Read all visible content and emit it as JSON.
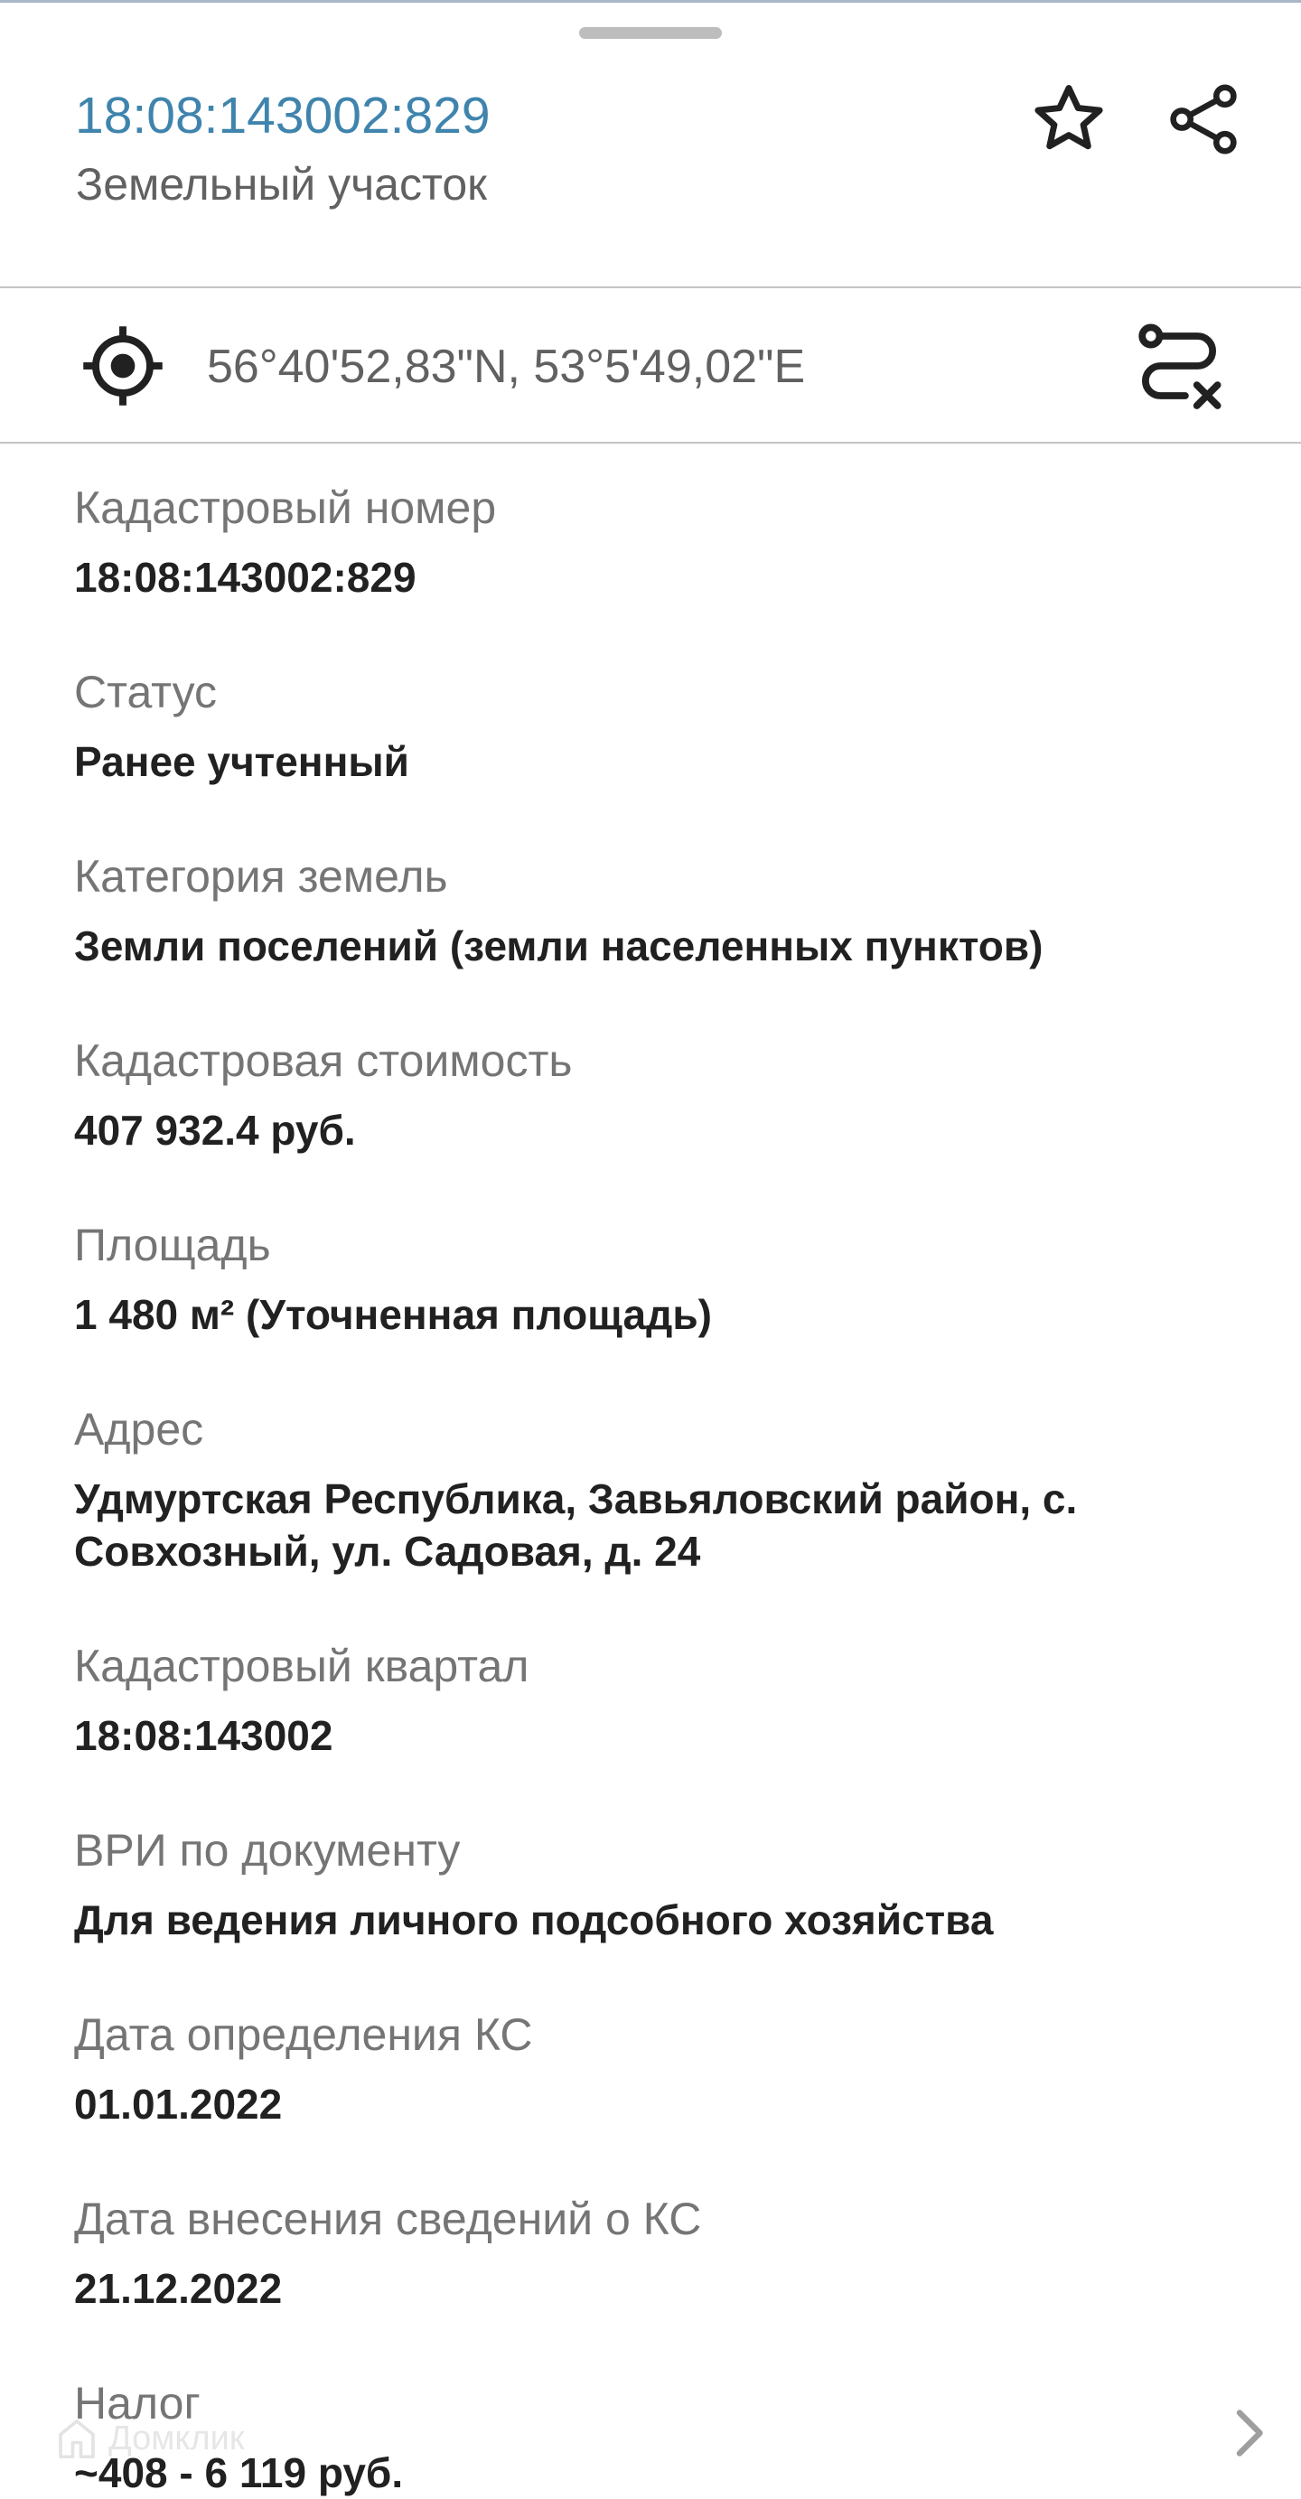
{
  "header": {
    "title": "18:08:143002:829",
    "subtitle": "Земельный участок",
    "accent_color": "#3f84ad",
    "star_icon": "star-outline-icon",
    "share_icon": "share-icon"
  },
  "coordinates": {
    "text": "56°40'52,83\"N, 53°5'49,02\"E",
    "locate_icon": "crosshair-icon",
    "route_icon": "route-icon"
  },
  "fields": [
    {
      "label": "Кадастровый номер",
      "value": "18:08:143002:829"
    },
    {
      "label": "Статус",
      "value": "Ранее учтенный"
    },
    {
      "label": "Категория земель",
      "value": "Земли поселений (земли населенных пунктов)"
    },
    {
      "label": "Кадастровая стоимость",
      "value": "407 932.4 руб."
    },
    {
      "label": "Площадь",
      "value": "1 480 м² (Уточненная площадь)"
    },
    {
      "label": "Адрес",
      "value_line1": "Удмуртская Республика, Завьяловский район, с.",
      "value_line2": "Совхозный, ул. Садовая, д. 24"
    },
    {
      "label": "Кадастровый квартал",
      "value": "18:08:143002"
    },
    {
      "label": "ВРИ по документу",
      "value": "Для ведения личного подсобного хозяйства"
    },
    {
      "label": "Дата определения КС",
      "value": "01.01.2022"
    },
    {
      "label": "Дата внесения сведений о КС",
      "value": "21.12.2022"
    },
    {
      "label": "Налог",
      "value": "~408 - 6 119 руб."
    }
  ],
  "watermark": {
    "text": "Домклик"
  }
}
